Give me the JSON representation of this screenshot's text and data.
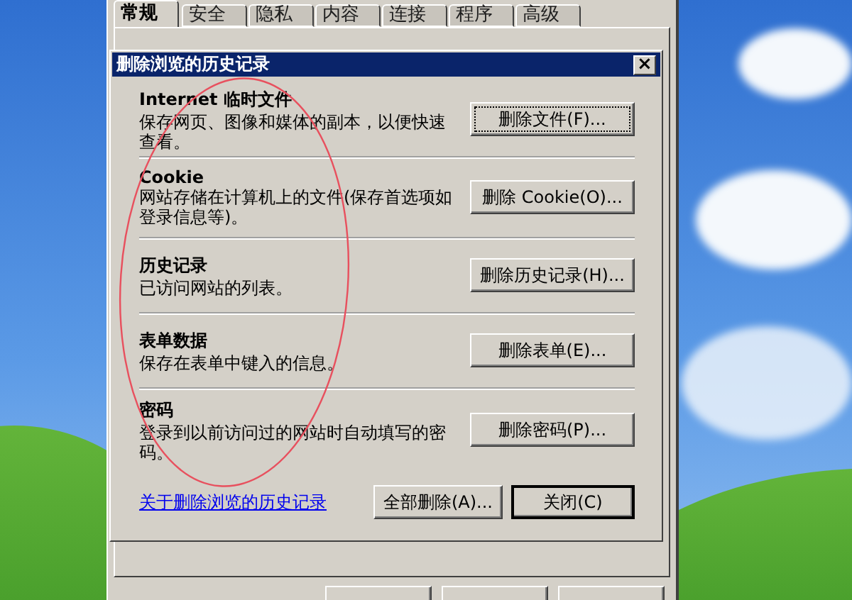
{
  "background_window": {
    "tabs": [
      {
        "label": "常规",
        "selected": true
      },
      {
        "label": "安全",
        "selected": false
      },
      {
        "label": "隐私",
        "selected": false
      },
      {
        "label": "内容",
        "selected": false
      },
      {
        "label": "连接",
        "selected": false
      },
      {
        "label": "程序",
        "selected": false
      },
      {
        "label": "高级",
        "selected": false
      }
    ]
  },
  "dialog": {
    "title": "删除浏览的历史记录",
    "close": "×",
    "sections": [
      {
        "heading": "Internet 临时文件",
        "description": "保存网页、图像和媒体的副本，以便快速查看。",
        "button": "删除文件(F)...",
        "focused": true
      },
      {
        "heading": "Cookie",
        "description": "网站存储在计算机上的文件(保存首选项如登录信息等)。",
        "button": "删除 Cookie(O)...",
        "focused": false
      },
      {
        "heading": "历史记录",
        "description": "已访问网站的列表。",
        "button": "删除历史记录(H)...",
        "focused": false
      },
      {
        "heading": "表单数据",
        "description": "保存在表单中键入的信息。",
        "button": "删除表单(E)...",
        "focused": false
      },
      {
        "heading": "密码",
        "description": "登录到以前访问过的网站时自动填写的密码。",
        "button": "删除密码(P)...",
        "focused": false
      }
    ],
    "link": "关于删除浏览的历史记录",
    "buttons": [
      {
        "label": "全部删除(A)...",
        "default": false
      },
      {
        "label": "关闭(C)",
        "default": true
      }
    ]
  }
}
